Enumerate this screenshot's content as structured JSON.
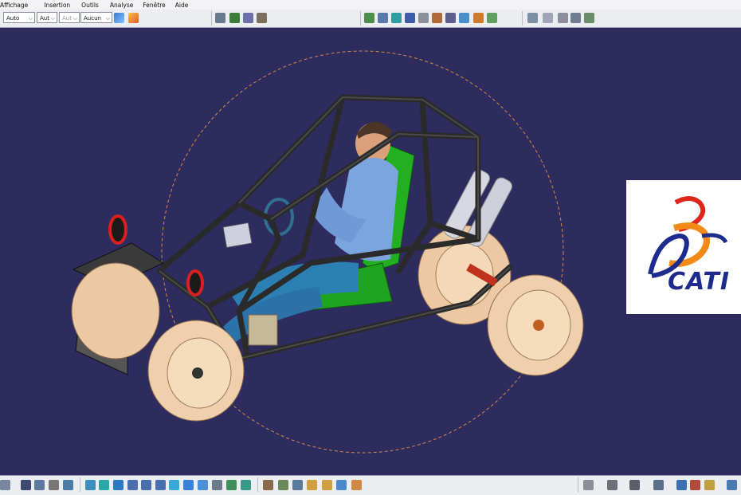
{
  "menubar": {
    "items": [
      {
        "label": "Affichage"
      },
      {
        "label": "Insertion"
      },
      {
        "label": "Outils"
      },
      {
        "label": "Analyse"
      },
      {
        "label": "Fenêtre"
      },
      {
        "label": "Aide"
      }
    ]
  },
  "toolbar": {
    "line_type_value": "Auto",
    "line_weight_value": "Aut",
    "point_value": "Aut",
    "layer_value": "Aucun"
  },
  "logo": {
    "brand_text": "CATI",
    "colors": {
      "red": "#e0261b",
      "orange": "#f18a16",
      "blue": "#1c2b8c"
    }
  },
  "scene": {
    "background": "#2e2b5f",
    "subject": "buggy-assembly-with-driver"
  },
  "icons": {
    "top": [
      "graphic-properties-icon",
      "painter-icon",
      "product-icon",
      "catalog-icon",
      "structure-icon",
      "insert-component-icon",
      "constraint-icon",
      "coincidence-icon",
      "contact-icon",
      "offset-icon",
      "angle-icon",
      "fix-icon",
      "fix-together-icon",
      "update-icon",
      "reuse-icon",
      "measure-icon",
      "measure-item-icon",
      "inertia-icon",
      "clash-icon"
    ],
    "bottom": [
      "view-icon",
      "render-icon",
      "tree-icon",
      "capture-icon",
      "filter-icon",
      "fit-all-icon",
      "pan-icon",
      "rotate-icon",
      "zoom-in-icon",
      "zoom-out-icon",
      "normal-view-icon",
      "quick-view-icon",
      "view-mode-icon",
      "hide-show-icon",
      "swap-icon",
      "manipulate-icon",
      "snap-icon",
      "explode-icon",
      "clash-check-icon",
      "sectioning-icon",
      "distance-icon",
      "scenes-icon",
      "rotate-free-icon",
      "tools-icon",
      "sketch-icon",
      "grid-icon",
      "compass-icon",
      "3d-icon"
    ]
  }
}
